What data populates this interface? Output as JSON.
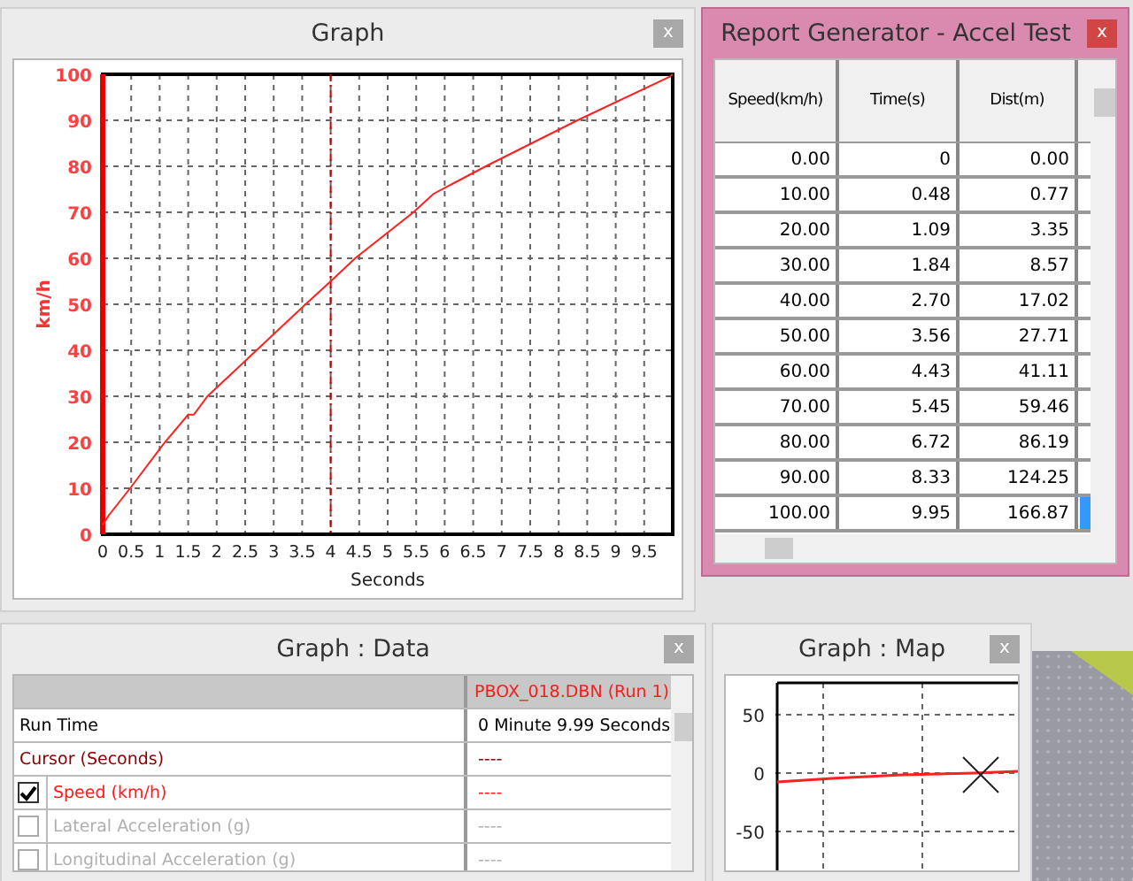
{
  "graph_window": {
    "title": "Graph",
    "close": "x",
    "chart_data": {
      "type": "line",
      "xlabel": "Seconds",
      "ylabel": "km/h",
      "xlim": [
        0,
        10
      ],
      "ylim": [
        0,
        100
      ],
      "xticks": [
        0,
        0.5,
        1,
        1.5,
        2,
        2.5,
        3,
        3.5,
        4,
        4.5,
        5,
        5.5,
        6,
        6.5,
        7,
        7.5,
        8,
        8.5,
        9,
        9.5
      ],
      "yticks": [
        0,
        10,
        20,
        30,
        40,
        50,
        60,
        70,
        80,
        90,
        100
      ],
      "grid": true,
      "series": [
        {
          "color": "#ff2020",
          "x": [
            0,
            0.1,
            0.48,
            1.09,
            1.5,
            1.6,
            1.84,
            2.7,
            3.56,
            4.0,
            4.43,
            5.45,
            5.8,
            6.72,
            8.33,
            9.95,
            10
          ],
          "values": [
            2,
            4,
            10,
            20,
            26,
            26,
            30,
            40,
            50,
            55,
            60,
            70,
            74,
            80,
            90,
            99.5,
            100
          ]
        }
      ],
      "ref_lines": [
        {
          "axis": "x",
          "value": 4,
          "color": "#c00000"
        }
      ]
    }
  },
  "report_window": {
    "title": "Report Generator - Accel Test",
    "close": "x",
    "columns": [
      "Speed(km/h)",
      "Time(s)",
      "Dist(m)"
    ],
    "rows": [
      [
        "0.00",
        "0",
        "0.00"
      ],
      [
        "10.00",
        "0.48",
        "0.77"
      ],
      [
        "20.00",
        "1.09",
        "3.35"
      ],
      [
        "30.00",
        "1.84",
        "8.57"
      ],
      [
        "40.00",
        "2.70",
        "17.02"
      ],
      [
        "50.00",
        "3.56",
        "27.71"
      ],
      [
        "60.00",
        "4.43",
        "41.11"
      ],
      [
        "70.00",
        "5.45",
        "59.46"
      ],
      [
        "80.00",
        "6.72",
        "86.19"
      ],
      [
        "90.00",
        "8.33",
        "124.25"
      ],
      [
        "100.00",
        "9.95",
        "166.87"
      ]
    ]
  },
  "data_window": {
    "title": "Graph : Data",
    "close": "x",
    "run_column": "PBOX_018.DBN (Run 1)",
    "rows": [
      {
        "kind": "info",
        "label": "Run Time",
        "value": "0 Minute 9.99 Seconds",
        "color": "#000000"
      },
      {
        "kind": "info",
        "label": "Cursor (Seconds)",
        "value": "----",
        "color": "#8b0000"
      },
      {
        "kind": "channel",
        "label": "Speed (km/h)",
        "value": "----",
        "checked": true
      },
      {
        "kind": "channel",
        "label": "Lateral Acceleration (g)",
        "value": "----",
        "checked": false
      },
      {
        "kind": "channel",
        "label": "Longitudinal Acceleration (g)",
        "value": "----",
        "checked": false
      }
    ]
  },
  "map_window": {
    "title": "Graph : Map",
    "close": "x",
    "y_labels": [
      "50",
      "0",
      "-50"
    ]
  }
}
